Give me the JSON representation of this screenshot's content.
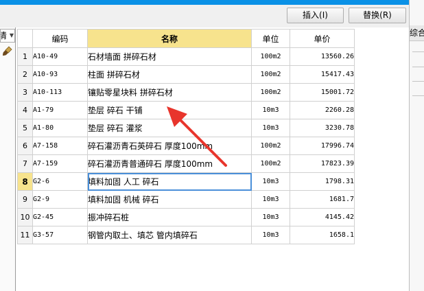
{
  "toolbar": {
    "insert_label": "插入(I)",
    "replace_label": "替换(R)"
  },
  "left_panel": {
    "combo_text": "清",
    "brush_icon": "brush-icon"
  },
  "right_panel": {
    "header_text": "综合"
  },
  "table": {
    "headers": [
      "",
      "编码",
      "名称",
      "单位",
      "单价"
    ],
    "rows": [
      {
        "idx": "1",
        "code": "A10-49",
        "name": "石材墙面 拼碎石材",
        "unit": "100m2",
        "price": "13560.26"
      },
      {
        "idx": "2",
        "code": "A10-93",
        "name": "柱面 拼碎石材",
        "unit": "100m2",
        "price": "15417.43"
      },
      {
        "idx": "3",
        "code": "A10-113",
        "name": "镶贴零星块料 拼碎石材",
        "unit": "100m2",
        "price": "15001.72"
      },
      {
        "idx": "4",
        "code": "A1-79",
        "name": "垫层 碎石 干铺",
        "unit": "10m3",
        "price": "2260.28"
      },
      {
        "idx": "5",
        "code": "A1-80",
        "name": "垫层 碎石 灌浆",
        "unit": "10m3",
        "price": "3230.78"
      },
      {
        "idx": "6",
        "code": "A7-158",
        "name": "碎石灌沥青石英碎石 厚度100mm",
        "unit": "100m2",
        "price": "17996.74"
      },
      {
        "idx": "7",
        "code": "A7-159",
        "name": "碎石灌沥青普通碎石 厚度100mm",
        "unit": "100m2",
        "price": "17823.39"
      },
      {
        "idx": "8",
        "code": "G2-6",
        "name": "填料加固 人工 碎石",
        "unit": "10m3",
        "price": "1798.31"
      },
      {
        "idx": "9",
        "code": "G2-9",
        "name": "填料加固 机械 碎石",
        "unit": "10m3",
        "price": "1681.7"
      },
      {
        "idx": "10",
        "code": "G2-45",
        "name": "振冲碎石桩",
        "unit": "10m3",
        "price": "4145.42"
      },
      {
        "idx": "11",
        "code": "G3-57",
        "name": "钢管内取土、填芯 管内填碎石",
        "unit": "10m3",
        "price": "1658.1"
      }
    ],
    "active_row": 7
  },
  "annotation": {
    "color": "#e8352c"
  }
}
